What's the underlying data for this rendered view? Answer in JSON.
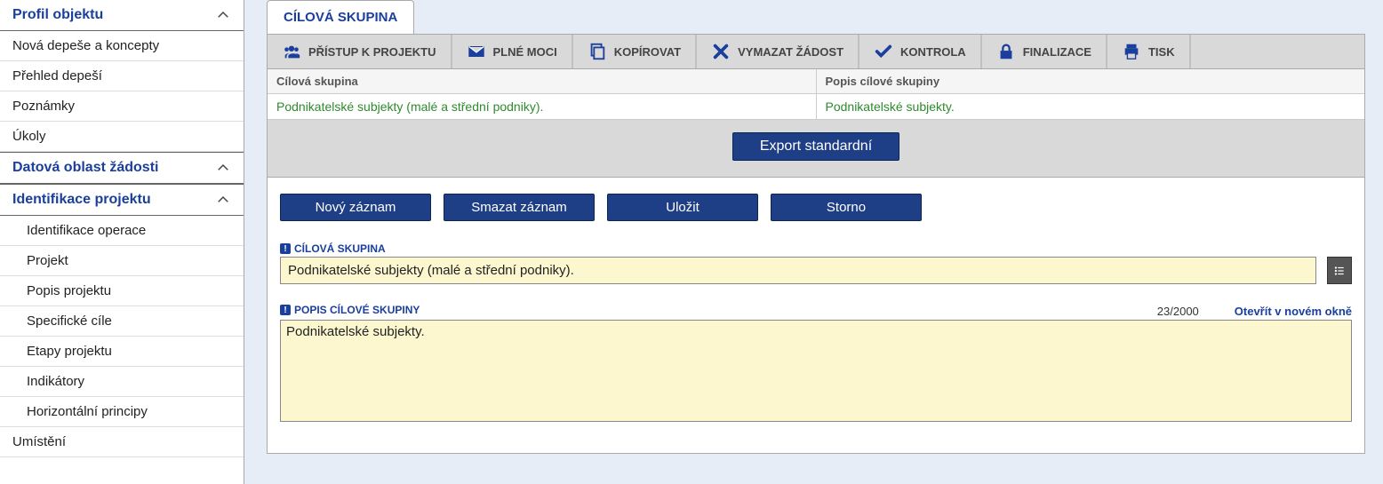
{
  "sidebar": {
    "sections": [
      {
        "title": "Profil objektu",
        "items": [
          "Nová depeše a koncepty",
          "Přehled depeší",
          "Poznámky",
          "Úkoly"
        ]
      },
      {
        "title": "Datová oblast žádosti",
        "items": []
      },
      {
        "title": "Identifikace projektu",
        "items": [
          "Identifikace operace",
          "Projekt",
          "Popis projektu",
          "Specifické cíle",
          "Etapy projektu",
          "Indikátory",
          "Horizontální principy"
        ],
        "indent": true
      },
      {
        "title": null,
        "items": [
          "Umístění"
        ]
      }
    ]
  },
  "tab": {
    "label": "CÍLOVÁ SKUPINA"
  },
  "toolbar": [
    {
      "id": "access",
      "label": "PŘÍSTUP K PROJEKTU",
      "icon": "people"
    },
    {
      "id": "power",
      "label": "PLNÉ MOCI",
      "icon": "mail"
    },
    {
      "id": "copy",
      "label": "KOPÍROVAT",
      "icon": "copy"
    },
    {
      "id": "delete",
      "label": "VYMAZAT ŽÁDOST",
      "icon": "x"
    },
    {
      "id": "check",
      "label": "KONTROLA",
      "icon": "check"
    },
    {
      "id": "finalize",
      "label": "FINALIZACE",
      "icon": "lock"
    },
    {
      "id": "print",
      "label": "TISK",
      "icon": "print"
    }
  ],
  "table": {
    "headers": [
      "Cílová skupina",
      "Popis cílové skupiny"
    ],
    "rows": [
      [
        "Podnikatelské subjekty (malé a střední podniky).",
        "Podnikatelské subjekty."
      ]
    ],
    "export_label": "Export standardní"
  },
  "crud": {
    "new": "Nový záznam",
    "delete": "Smazat záznam",
    "save": "Uložit",
    "cancel": "Storno"
  },
  "form": {
    "group_label": "CÍLOVÁ SKUPINA",
    "group_value": "Podnikatelské subjekty (malé a střední podniky).",
    "desc_label": "POPIS CÍLOVÉ SKUPINY",
    "desc_value": "Podnikatelské subjekty.",
    "counter": "23/2000",
    "open_window": "Otevřít v novém okně"
  }
}
